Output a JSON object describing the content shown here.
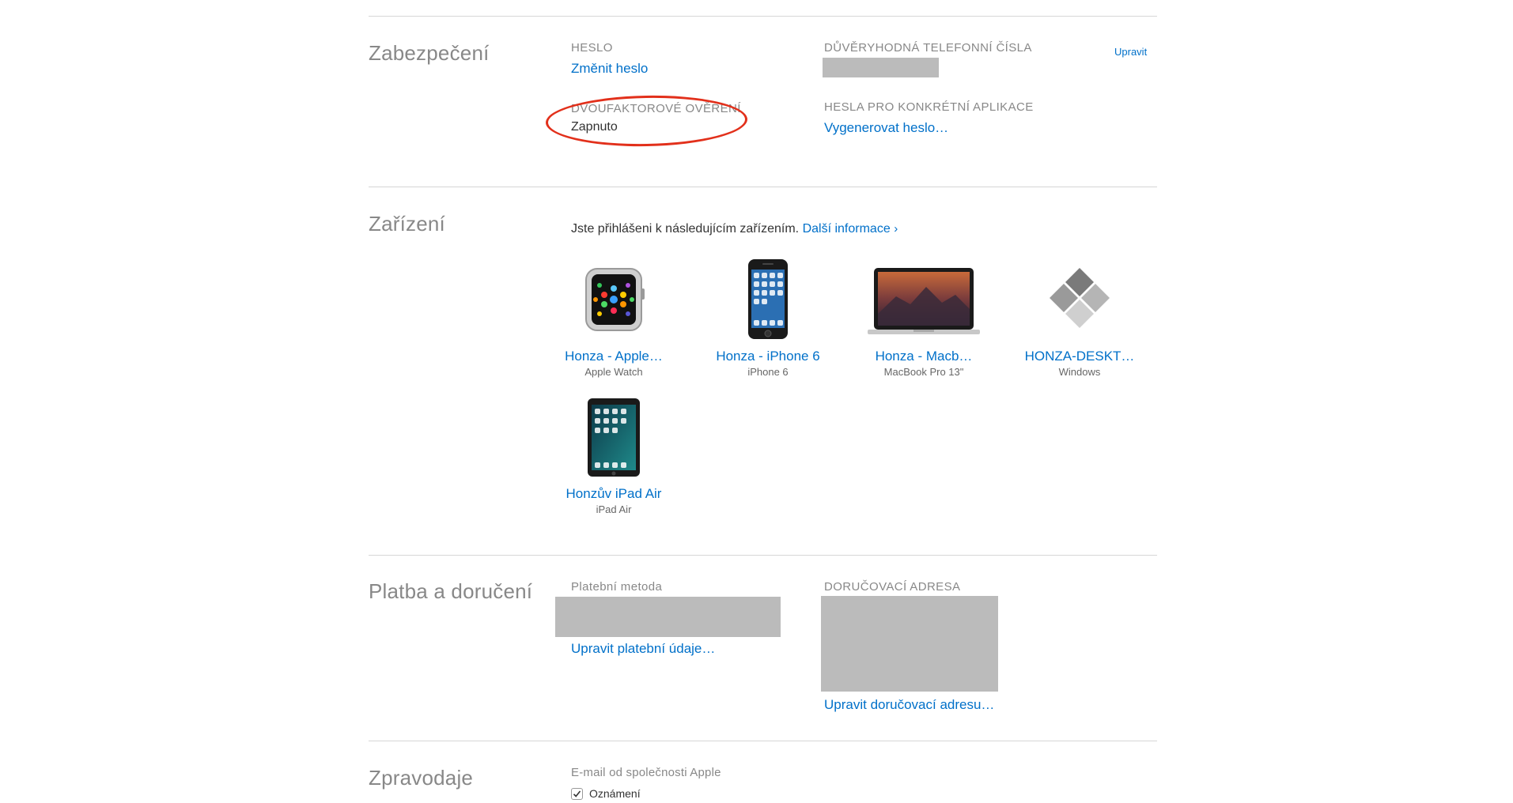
{
  "security": {
    "title": "Zabezpečení",
    "password_label": "HESLO",
    "password_link": "Změnit heslo",
    "two_factor_label": "DVOUFAKTOROVÉ OVĚŘENÍ",
    "two_factor_value": "Zapnuto",
    "trusted_phones_label": "DŮVĚRYHODNÁ TELEFONNÍ ČÍSLA",
    "edit_link": "Upravit",
    "app_passwords_label": "HESLA PRO KONKRÉTNÍ APLIKACE",
    "app_passwords_link": "Vygenerovat heslo…"
  },
  "devices": {
    "title": "Zařízení",
    "intro": "Jste přihlášeni k následujícím zařízením.",
    "more_info_link": "Další informace",
    "more_info_chevron": "›",
    "items": [
      {
        "name": "Honza - Apple…",
        "model": "Apple Watch",
        "icon": "apple-watch-icon"
      },
      {
        "name": "Honza - iPhone 6",
        "model": "iPhone 6",
        "icon": "iphone-icon"
      },
      {
        "name": "Honza - Macb…",
        "model": "MacBook Pro 13\"",
        "icon": "macbook-icon"
      },
      {
        "name": "HONZA-DESKT…",
        "model": "Windows",
        "icon": "windows-diamond-icon"
      },
      {
        "name": "Honzův iPad Air",
        "model": "iPad Air",
        "icon": "ipad-icon"
      }
    ]
  },
  "payment": {
    "title": "Platba a doručení",
    "method_label": "Platební metoda",
    "method_link": "Upravit platební údaje…",
    "address_label": "DORUČOVACÍ ADRESA",
    "address_link": "Upravit doručovací adresu…"
  },
  "newsletter": {
    "title": "Zpravodaje",
    "email_label": "E-mail od společnosti Apple",
    "announcements_label": "Oznámení",
    "announcements_checked": true
  },
  "colors": {
    "link": "#0070c9",
    "annotation": "#e2301b",
    "redaction": "#bbbbbb"
  }
}
